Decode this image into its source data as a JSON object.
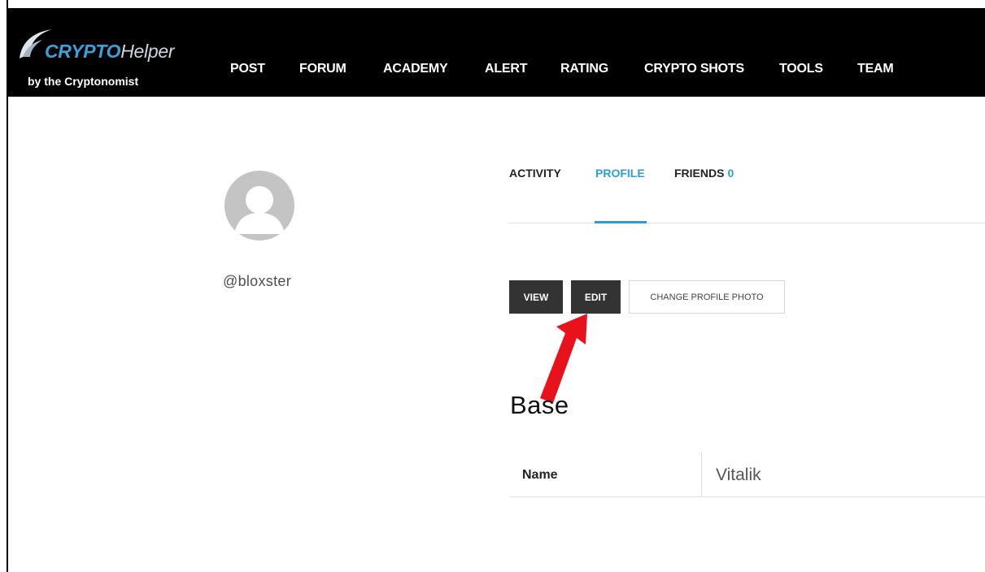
{
  "brand": {
    "title_bold": "CRYPTO",
    "title_light": "Helper",
    "subtitle": "by the Cryptonomist"
  },
  "nav": {
    "items": [
      "POST",
      "FORUM",
      "ACADEMY",
      "ALERT",
      "RATING",
      "CRYPTO SHOTS",
      "TOOLS",
      "TEAM"
    ]
  },
  "profile": {
    "username": "@bloxster"
  },
  "tabs": {
    "activity": "ACTIVITY",
    "profile": "PROFILE",
    "friends": "FRIENDS",
    "friends_count": "0"
  },
  "actions": {
    "view": "VIEW",
    "edit": "EDIT",
    "change_photo": "CHANGE PROFILE PHOTO"
  },
  "section": {
    "title": "Base",
    "fields": [
      {
        "label": "Name",
        "value": "Vitalik"
      }
    ]
  },
  "colors": {
    "accent": "#2a9fd6",
    "navbar_bg": "#000000",
    "button_dark": "#333333",
    "annotation_arrow": "#e8121d"
  }
}
